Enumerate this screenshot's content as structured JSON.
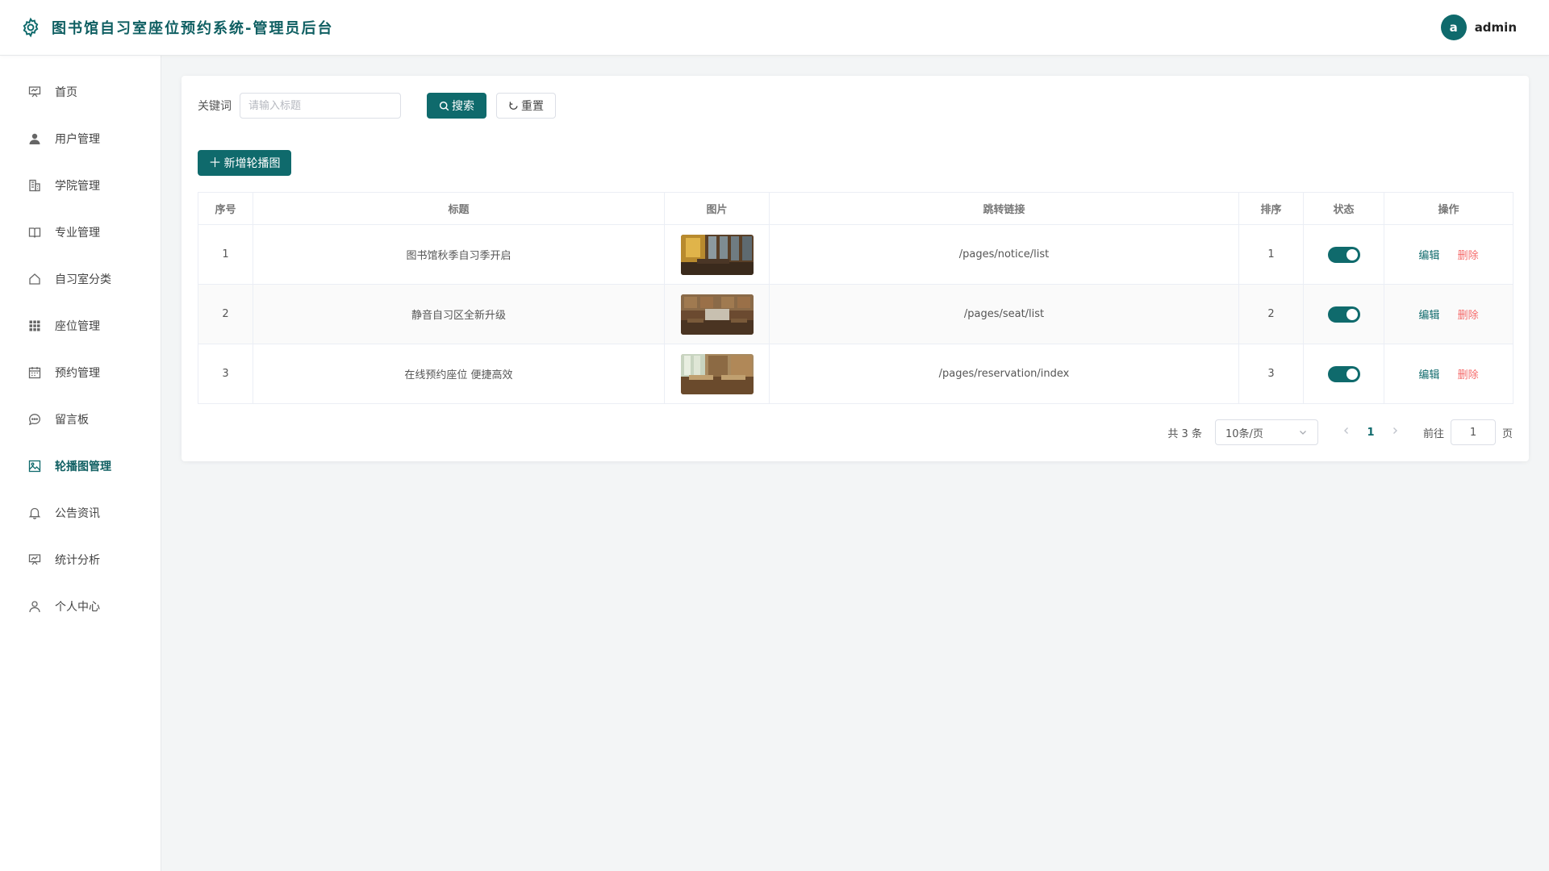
{
  "header": {
    "title": "图书馆自习室座位预约系统-管理员后台",
    "avatar_letter": "a",
    "username": "admin"
  },
  "sidebar": {
    "items": [
      {
        "label": "首页",
        "icon": "presentation-icon"
      },
      {
        "label": "用户管理",
        "icon": "user-icon"
      },
      {
        "label": "学院管理",
        "icon": "building-icon"
      },
      {
        "label": "专业管理",
        "icon": "book-icon"
      },
      {
        "label": "自习室分类",
        "icon": "home-icon"
      },
      {
        "label": "座位管理",
        "icon": "grid-icon"
      },
      {
        "label": "预约管理",
        "icon": "calendar-icon"
      },
      {
        "label": "留言板",
        "icon": "chat-icon"
      },
      {
        "label": "轮播图管理",
        "icon": "image-icon",
        "active": true
      },
      {
        "label": "公告资讯",
        "icon": "bell-icon"
      },
      {
        "label": "统计分析",
        "icon": "chart-board-icon"
      },
      {
        "label": "个人中心",
        "icon": "user-outline-icon"
      }
    ]
  },
  "search": {
    "label": "关键词",
    "placeholder": "请输入标题",
    "value": "",
    "search_button": "搜索",
    "reset_button": "重置"
  },
  "add_button": "新增轮播图",
  "table": {
    "columns": [
      "序号",
      "标题",
      "图片",
      "跳转链接",
      "排序",
      "状态",
      "操作"
    ],
    "rows": [
      {
        "index": "1",
        "title": "图书馆秋季自习季开启",
        "link": "/pages/notice/list",
        "sort": "1",
        "enabled": true
      },
      {
        "index": "2",
        "title": "静音自习区全新升级",
        "link": "/pages/seat/list",
        "sort": "2",
        "enabled": true
      },
      {
        "index": "3",
        "title": "在线预约座位 便捷高效",
        "link": "/pages/reservation/index",
        "sort": "3",
        "enabled": true
      }
    ],
    "edit_label": "编辑",
    "delete_label": "删除"
  },
  "pagination": {
    "total_text": "共 3 条",
    "page_size": "10条/页",
    "current_page": "1",
    "goto_label": "前往",
    "goto_value": "1",
    "goto_suffix": "页"
  },
  "colors": {
    "primary": "#0f6a6c",
    "danger": "#f56c6c"
  }
}
